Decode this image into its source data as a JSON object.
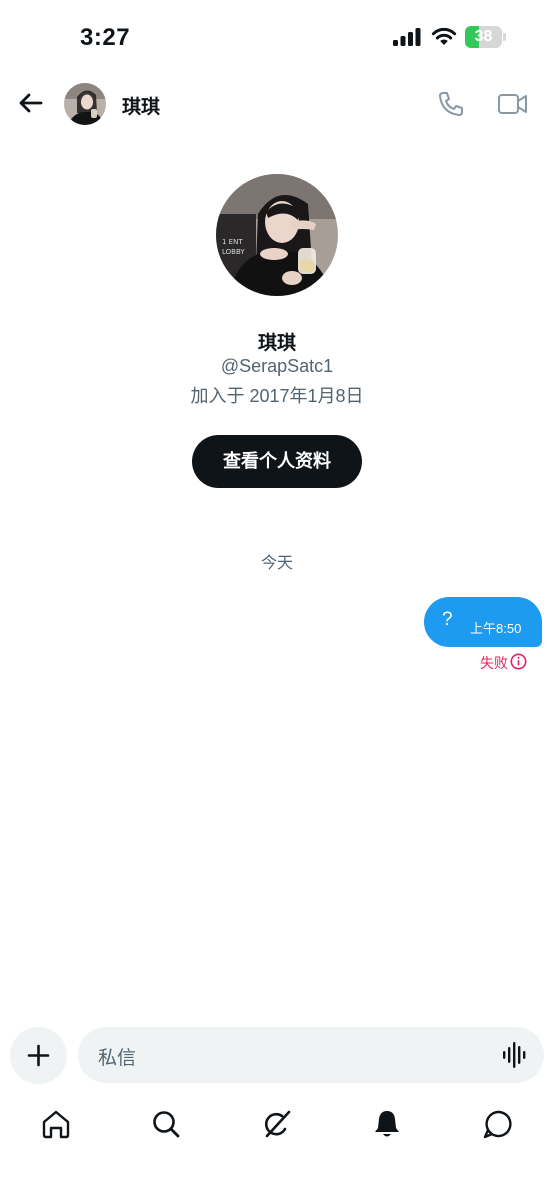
{
  "status_bar": {
    "time": "3:27",
    "battery_percent": "38",
    "battery_level": 0.38
  },
  "header": {
    "back_icon": "arrow-left-icon",
    "contact_name": "琪琪",
    "phone_icon": "phone-icon",
    "video_icon": "video-camera-icon"
  },
  "profile": {
    "name": "琪琪",
    "handle": "@SerapSatc1",
    "joined": "加入于 2017年1月8日",
    "view_profile_label": "查看个人资料"
  },
  "conversation": {
    "date_divider": "今天",
    "messages": [
      {
        "text": "?",
        "time": "上午8:50",
        "status": "失败"
      }
    ]
  },
  "composer": {
    "add_icon": "plus-icon",
    "placeholder": "私信",
    "voice_icon": "voice-waveform-icon"
  },
  "bottom_nav": {
    "items": [
      "home-icon",
      "search-icon",
      "grok-icon",
      "notifications-bell-icon",
      "messages-icon"
    ]
  },
  "colors": {
    "accent": "#1d9bf0",
    "text_primary": "#0f1419",
    "text_secondary": "#536471",
    "error": "#e0245e",
    "input_background": "#eff3f4",
    "battery_green": "#34c759"
  }
}
